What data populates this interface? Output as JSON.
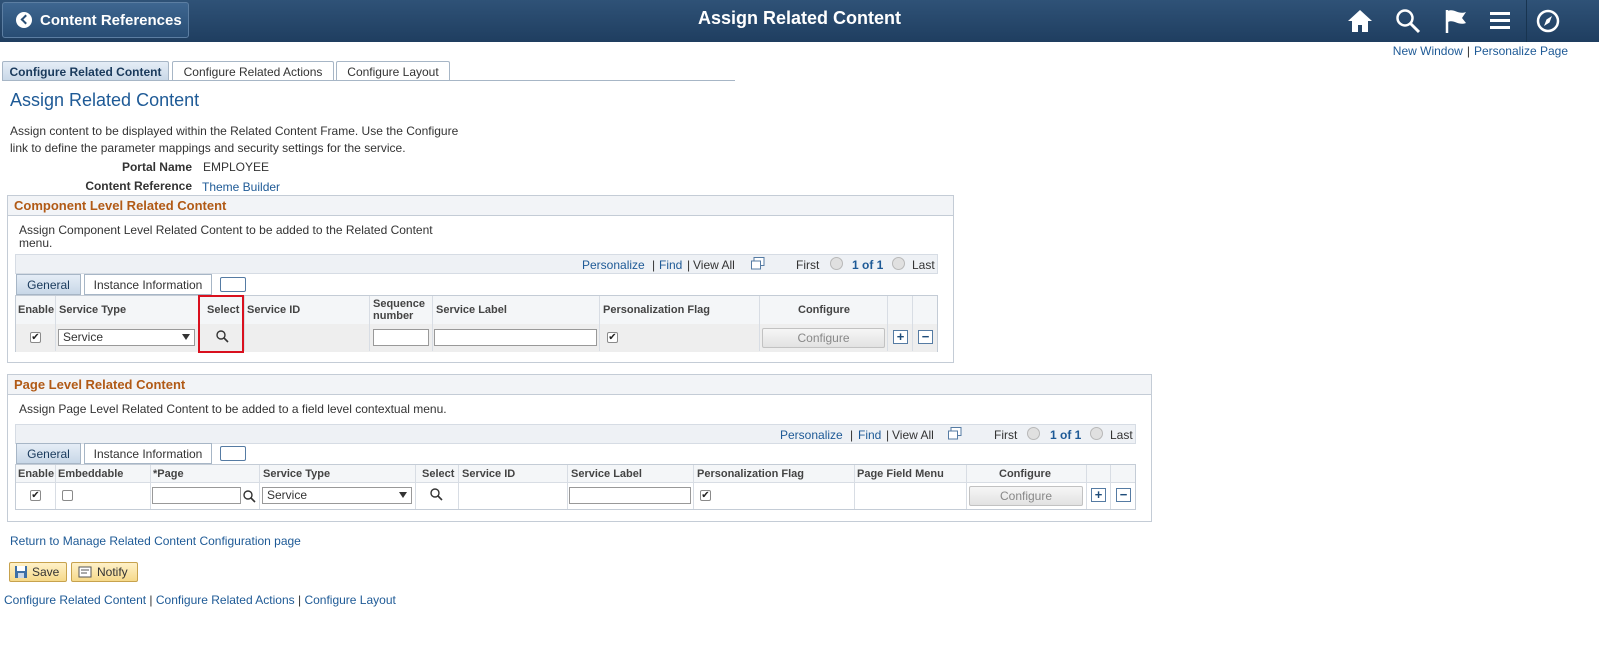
{
  "header": {
    "back_label": "Content References",
    "title": "Assign Related Content",
    "icons": [
      "home-icon",
      "search-icon",
      "flag-icon",
      "menu-icon",
      "navbar-compass-icon"
    ]
  },
  "top_links": {
    "new_window": "New Window",
    "personalize_page": "Personalize Page"
  },
  "tabs": [
    "Configure Related Content",
    "Configure Related Actions",
    "Configure Layout"
  ],
  "page_heading": "Assign Related Content",
  "description_line1": "Assign content to be displayed within the Related Content Frame. Use the Configure",
  "description_line2": "link to define the parameter mappings and security settings for the service.",
  "portal_name": {
    "label": "Portal Name",
    "value": "EMPLOYEE"
  },
  "content_reference": {
    "label": "Content Reference",
    "value": "Theme Builder"
  },
  "component_section": {
    "title": "Component Level Related Content",
    "desc_line1": "Assign Component Level Related Content to be added to the Related Content",
    "desc_line2": "menu.",
    "nav": {
      "personalize": "Personalize",
      "find": "Find",
      "view_all": "View All",
      "first": "First",
      "count": "1 of 1",
      "last": "Last"
    },
    "grid_tabs": [
      "General",
      "Instance Information"
    ],
    "columns": [
      "Enable",
      "Service Type",
      "Select",
      "Service ID",
      "Sequence",
      "number",
      "Service Label",
      "Personalization Flag",
      "Configure"
    ],
    "row": {
      "enable": true,
      "service_type": "Service",
      "personalization_flag": true,
      "configure_label": "Configure"
    }
  },
  "page_section": {
    "title": "Page Level Related Content",
    "desc": "Assign Page Level Related Content to be added to a field level contextual menu.",
    "nav": {
      "personalize": "Personalize",
      "find": "Find",
      "view_all": "View All",
      "first": "First",
      "count": "1 of 1",
      "last": "Last"
    },
    "grid_tabs": [
      "General",
      "Instance Information"
    ],
    "columns": [
      "Enable",
      "Embeddable",
      "*Page",
      "Service Type",
      "Select",
      "Service ID",
      "Service Label",
      "Personalization Flag",
      "Page Field Menu",
      "Configure"
    ],
    "row": {
      "enable": true,
      "embeddable": false,
      "service_type": "Service",
      "personalization_flag": true,
      "configure_label": "Configure"
    }
  },
  "return_link": "Return to Manage Related Content Configuration page",
  "buttons": {
    "save": "Save",
    "notify": "Notify"
  },
  "footer_links": [
    "Configure Related Content",
    "Configure Related Actions",
    "Configure Layout"
  ],
  "colors": {
    "banner": "#1f3e60",
    "link": "#1e5a96",
    "section_title": "#b15a16",
    "highlight": "#d9101e"
  }
}
